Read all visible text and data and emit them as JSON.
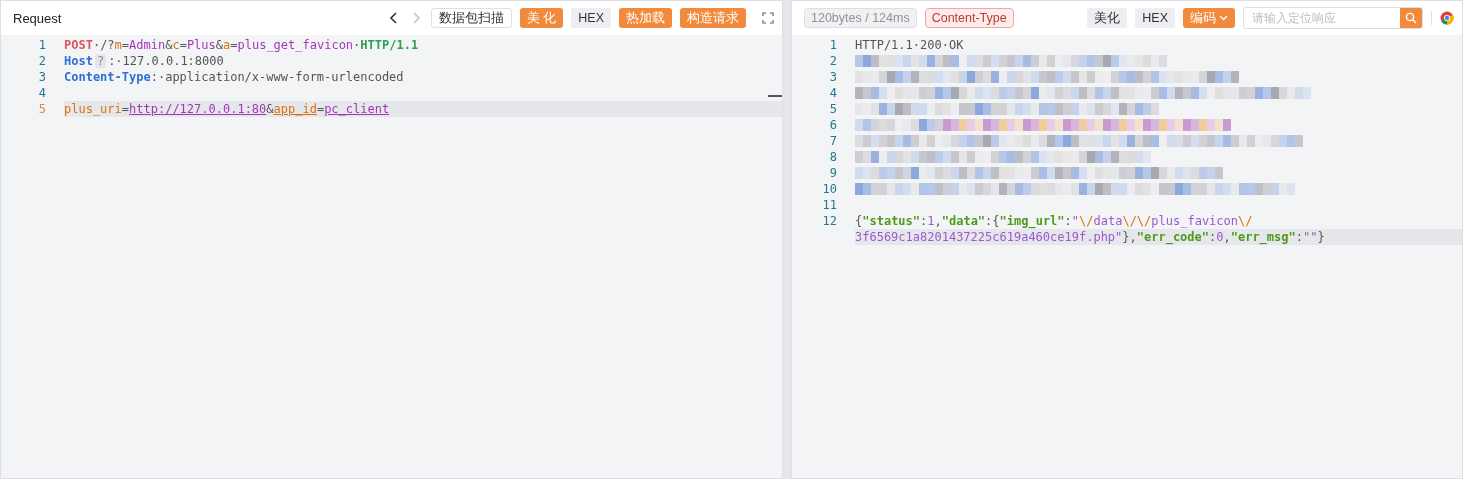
{
  "request": {
    "title": "Request",
    "toolbar": [
      {
        "kind": "prev",
        "disabled": false
      },
      {
        "kind": "next",
        "disabled": true
      },
      {
        "kind": "outline",
        "label": "数据包扫描"
      },
      {
        "kind": "primary",
        "label": "美 化"
      },
      {
        "kind": "plain",
        "label": "HEX"
      },
      {
        "kind": "primary",
        "label": "热加载"
      },
      {
        "kind": "primary",
        "label": "构造请求"
      },
      {
        "kind": "expand"
      }
    ],
    "lines": [
      {
        "number": "1",
        "current": false,
        "kind": "code",
        "segments": [
          {
            "tokens": [
              {
                "text": "POST",
                "kind": "method"
              },
              {
                "text": "·/?",
                "kind": "plain"
              },
              {
                "text": "m",
                "kind": "key"
              },
              {
                "text": "=",
                "kind": "plain"
              },
              {
                "text": "Admin",
                "kind": "value"
              },
              {
                "text": "&",
                "kind": "plain"
              },
              {
                "text": "c",
                "kind": "key"
              },
              {
                "text": "=",
                "kind": "plain"
              },
              {
                "text": "Plus",
                "kind": "value"
              },
              {
                "text": "&",
                "kind": "plain"
              },
              {
                "text": "a",
                "kind": "key"
              },
              {
                "text": "=",
                "kind": "plain"
              },
              {
                "text": "plus_get_favicon",
                "kind": "value"
              },
              {
                "text": "·",
                "kind": "plain"
              },
              {
                "text": "HTTP/1.1",
                "kind": "version"
              }
            ]
          }
        ]
      },
      {
        "number": "2",
        "current": false,
        "kind": "code",
        "segments": [
          {
            "tokens": [
              {
                "text": "Host",
                "kind": "header"
              },
              {
                "text": "?",
                "kind": "badge"
              },
              {
                "text": ":·127.0.0.1:8000",
                "kind": "plain"
              }
            ]
          }
        ]
      },
      {
        "number": "3",
        "current": false,
        "kind": "code",
        "segments": [
          {
            "tokens": [
              {
                "text": "Content-Type",
                "kind": "header"
              },
              {
                "text": ":·application/x-www-form-urlencoded",
                "kind": "plain"
              }
            ]
          }
        ]
      },
      {
        "number": "4",
        "current": false,
        "kind": "blank"
      },
      {
        "number": "5",
        "current": true,
        "kind": "code",
        "segments": [
          {
            "tokens": [
              {
                "text": "plus_uri",
                "kind": "key"
              },
              {
                "text": "=",
                "kind": "plain"
              },
              {
                "text": "http://127.0.0.1:80",
                "kind": "link"
              },
              {
                "text": "&",
                "kind": "plain"
              },
              {
                "text": "app_id",
                "kind": "keyline"
              },
              {
                "text": "=",
                "kind": "plain"
              },
              {
                "text": "pc_client",
                "kind": "link"
              }
            ]
          }
        ]
      }
    ]
  },
  "response": {
    "stats": "120bytes / 124ms",
    "tag": "Content-Type",
    "toolbar": [
      {
        "kind": "plain",
        "label": "美化"
      },
      {
        "kind": "plain",
        "label": "HEX"
      },
      {
        "kind": "dropdown",
        "label": "编码"
      }
    ],
    "search": {
      "placeholder": "请输入定位响应"
    },
    "lines": [
      {
        "number": "1",
        "kind": "code",
        "segments": [
          {
            "tokens": [
              {
                "text": "HTTP/1.1·200·OK",
                "kind": "plain"
              }
            ]
          }
        ]
      },
      {
        "number": "2",
        "kind": "redacted"
      },
      {
        "number": "3",
        "kind": "redacted"
      },
      {
        "number": "4",
        "kind": "redacted"
      },
      {
        "number": "5",
        "kind": "redacted"
      },
      {
        "number": "6",
        "kind": "redacted"
      },
      {
        "number": "7",
        "kind": "redacted"
      },
      {
        "number": "8",
        "kind": "redacted"
      },
      {
        "number": "9",
        "kind": "redacted"
      },
      {
        "number": "10",
        "kind": "redacted"
      },
      {
        "number": "11",
        "kind": "blank"
      },
      {
        "number": "12",
        "current": true,
        "kind": "code",
        "segments": [
          {
            "tokens": [
              {
                "text": "{",
                "kind": "plain"
              },
              {
                "text": "\"status\"",
                "kind": "jkey"
              },
              {
                "text": ":",
                "kind": "plain"
              },
              {
                "text": "1",
                "kind": "value"
              },
              {
                "text": ",",
                "kind": "plain"
              },
              {
                "text": "\"data\"",
                "kind": "jkey"
              },
              {
                "text": ":{",
                "kind": "plain"
              },
              {
                "text": "\"img_url\"",
                "kind": "jkey"
              },
              {
                "text": ":",
                "kind": "plain"
              },
              {
                "text": "\"",
                "kind": "value"
              },
              {
                "text": "\\/",
                "kind": "key"
              },
              {
                "text": "data",
                "kind": "value"
              },
              {
                "text": "\\/\\/",
                "kind": "key"
              },
              {
                "text": "plus_favicon",
                "kind": "value"
              },
              {
                "text": "\\/",
                "kind": "key"
              }
            ]
          },
          {
            "tokens": [
              {
                "text": "3f6569c1a8201437225c619a460ce19f.php\"",
                "kind": "value"
              },
              {
                "text": "},",
                "kind": "plain"
              },
              {
                "text": "\"err_code\"",
                "kind": "jkey"
              },
              {
                "text": ":",
                "kind": "plain"
              },
              {
                "text": "0",
                "kind": "value"
              },
              {
                "text": ",",
                "kind": "plain"
              },
              {
                "text": "\"err_msg\"",
                "kind": "jkey"
              },
              {
                "text": ":",
                "kind": "plain"
              },
              {
                "text": "\"\"",
                "kind": "value"
              },
              {
                "text": "}",
                "kind": "plain"
              }
            ]
          }
        ]
      }
    ]
  }
}
